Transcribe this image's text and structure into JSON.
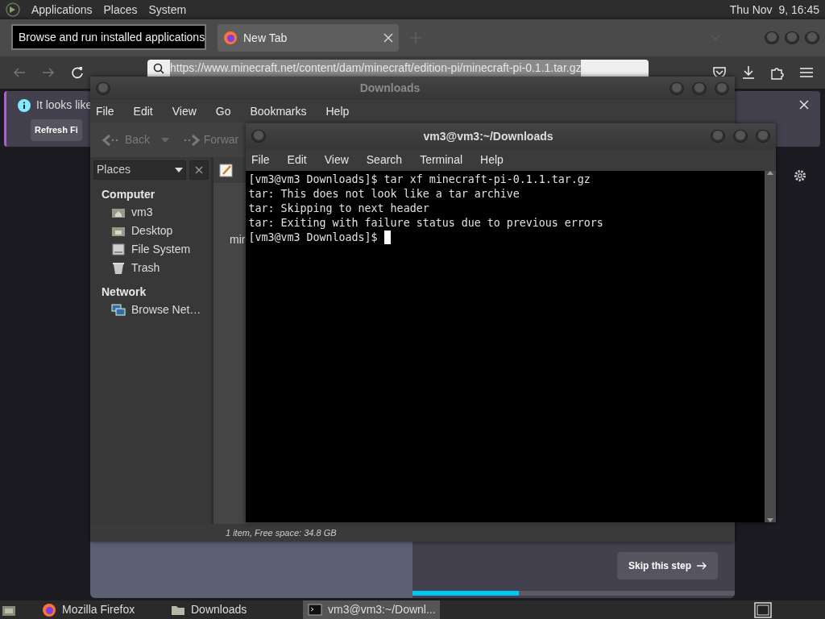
{
  "top_panel": {
    "menus": [
      "Applications",
      "Places",
      "System"
    ],
    "clock": "Thu Nov  9, 16:45"
  },
  "tooltip": "Browse and run installed applications",
  "browser": {
    "tabs": [
      {
        "label": "New Tab",
        "selected": true
      }
    ],
    "url": "https://www.minecraft.net/content/dam/minecraft/edition-pi/minecraft-pi-0.1.1.tar.gz",
    "notification": {
      "text": "It looks like",
      "button": "Refresh Fi"
    },
    "skip_button": "Skip this step",
    "progress": {
      "level": 0.33
    }
  },
  "file_manager": {
    "title": "Downloads",
    "menu": [
      "File",
      "Edit",
      "View",
      "Go",
      "Bookmarks",
      "Help"
    ],
    "toolbar": [
      "Back",
      "Forwar"
    ],
    "places_label": "Places",
    "sections": [
      {
        "label": "Computer",
        "items": [
          {
            "label": "vm3",
            "kind": "home"
          },
          {
            "label": "Desktop",
            "kind": "desktop"
          },
          {
            "label": "File System",
            "kind": "drive"
          },
          {
            "label": "Trash",
            "kind": "trash"
          }
        ]
      },
      {
        "label": "Network",
        "items": [
          {
            "label": "Browse Net…",
            "kind": "network"
          }
        ]
      }
    ],
    "file_label": "mir",
    "status": "1 item, Free space: 34.8 GB"
  },
  "terminal": {
    "title": "vm3@vm3:~/Downloads",
    "menu": [
      "File",
      "Edit",
      "View",
      "Search",
      "Terminal",
      "Help"
    ],
    "lines": [
      "[vm3@vm3 Downloads]$ tar xf minecraft-pi-0.1.1.tar.gz",
      "tar: This does not look like a tar archive",
      "tar: Skipping to next header",
      "tar: Exiting with failure status due to previous errors"
    ],
    "prompt": "[vm3@vm3 Downloads]$ "
  },
  "taskbar": [
    {
      "label": "Mozilla Firefox",
      "kind": "firefox",
      "selected": false
    },
    {
      "label": "Downloads",
      "kind": "folder",
      "selected": false
    },
    {
      "label": "vm3@vm3:~/Downl...",
      "kind": "terminal",
      "selected": true
    }
  ]
}
